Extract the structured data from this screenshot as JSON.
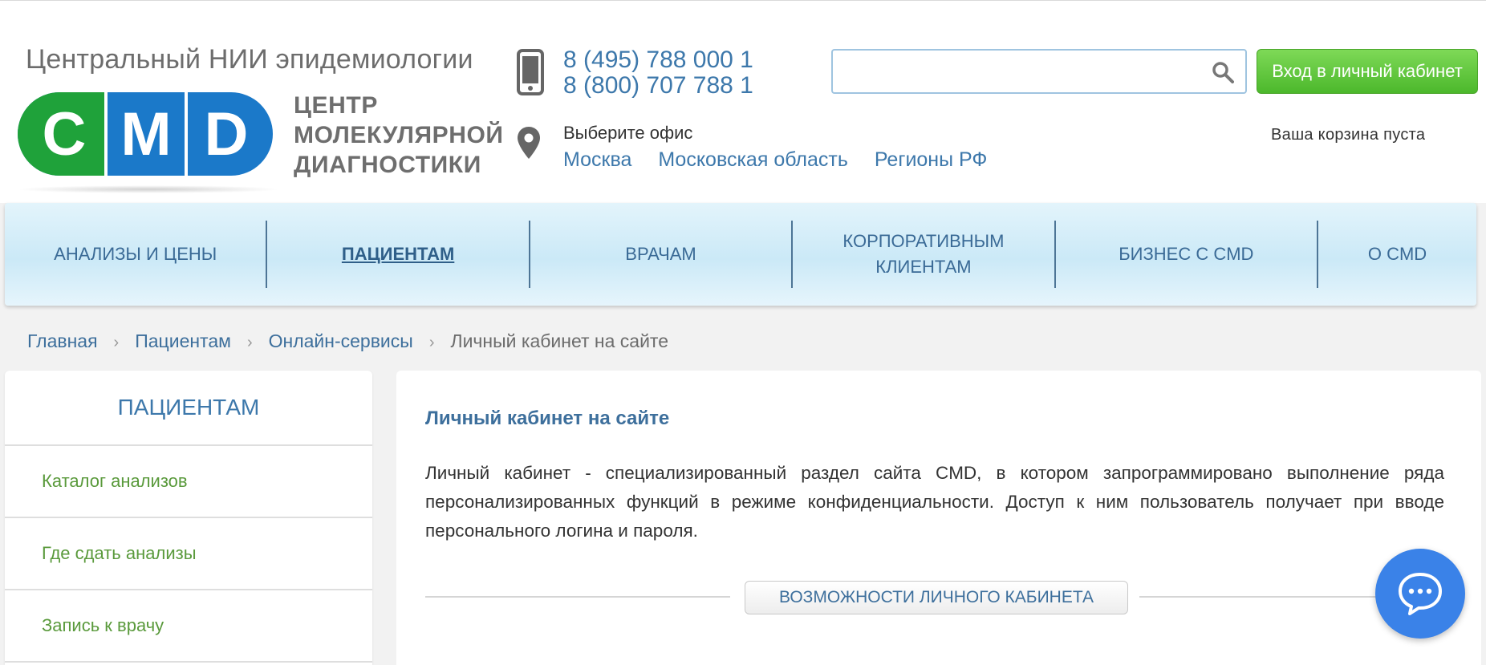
{
  "header": {
    "org_name": "Центральный НИИ эпидемиологии",
    "logo_text": "CMD",
    "logo_sub": [
      "ЦЕНТР",
      "МОЛЕКУЛЯРНОЙ",
      "ДИАГНОСТИКИ"
    ],
    "phones": [
      "8 (495) 788 000 1",
      "8 (800) 707 788 1"
    ],
    "office_label": "Выберите офис",
    "offices": [
      "Москва",
      "Московская область",
      "Регионы РФ"
    ],
    "search": {
      "placeholder": ""
    },
    "login_label": "Вход в личный кабинет",
    "cart_text": "Ваша корзина пуста",
    "colors": {
      "green": "#1fa23a",
      "blue": "#1b79c9",
      "login": "#5fc63d"
    }
  },
  "nav": {
    "items": [
      "АНАЛИЗЫ И ЦЕНЫ",
      "ПАЦИЕНТАМ",
      "ВРАЧАМ",
      "КОРПОРАТИВНЫМ КЛИЕНТАМ",
      "БИЗНЕС С CMD",
      "О CMD"
    ],
    "active": "ПАЦИЕНТАМ"
  },
  "breadcrumb": {
    "items": [
      "Главная",
      "Пациентам",
      "Онлайн-сервисы"
    ],
    "current": "Личный кабинет на сайте"
  },
  "sidebar": {
    "title": "ПАЦИЕНТАМ",
    "items": [
      "Каталог анализов",
      "Где сдать анализы",
      "Запись к врачу"
    ]
  },
  "content": {
    "title": "Личный кабинет на сайте",
    "text": "Личный кабинет - специализированный раздел сайта CMD, в котором запрограммировано выполнение ряда персонализированных функций в режиме конфиденциальности. Доступ к ним пользователь получает при вводе персонального логина и пароля.",
    "section_label": "ВОЗМОЖНОСТИ ЛИЧНОГО КАБИНЕТА"
  },
  "icons": [
    "phone-icon",
    "location-pin-icon",
    "search-icon",
    "chat-icon"
  ]
}
